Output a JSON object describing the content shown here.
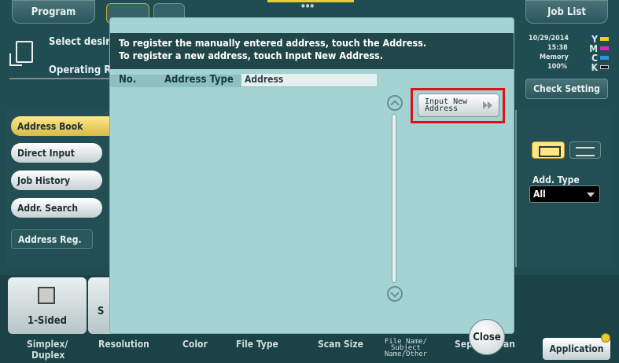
{
  "topbar": {
    "program_tab": "Program",
    "job_list_tab": "Job List"
  },
  "message_area": {
    "select_text": "Select desire",
    "operating_text": "Operating R"
  },
  "status": {
    "date": "10/29/2014",
    "time": "15:38",
    "memory_label": "Memory",
    "memory_value": "100%",
    "toner": [
      {
        "letter": "Y",
        "color": "#e6d21b"
      },
      {
        "letter": "M",
        "color": "#d62ab6"
      },
      {
        "letter": "C",
        "color": "#2f8fe0"
      },
      {
        "letter": "K",
        "color": "#111111"
      }
    ]
  },
  "check_setting_label": "Check Setting",
  "sidebar": {
    "items": [
      {
        "label": "Address Book",
        "selected": true
      },
      {
        "label": "Direct Input"
      },
      {
        "label": "Job History"
      },
      {
        "label": "Addr. Search"
      }
    ],
    "address_reg_label": "Address Reg."
  },
  "right_panel": {
    "add_type_label": "Add. Type",
    "add_type_value": "All"
  },
  "bottom": {
    "one_sided_label": "1-Sided",
    "scan_peek_label": "S",
    "func_labels": {
      "simplex": "Simplex/",
      "duplex": "Duplex",
      "resolution": "Resolution",
      "color": "Color",
      "file_type": "File Type",
      "scan_size": "Scan Size",
      "file_name": "File Name/ Subject Name/Other",
      "sep": "Sep",
      "an": "an"
    },
    "application_label": "Application"
  },
  "dialog": {
    "line1": "To register the manually entered address, touch the Address.",
    "line2": "To register a new address, touch Input New Address.",
    "columns": {
      "no": "No.",
      "address_type": "Address Type",
      "address": "Address"
    },
    "input_new_address_label": "Input New Address",
    "close_label": "Close"
  }
}
